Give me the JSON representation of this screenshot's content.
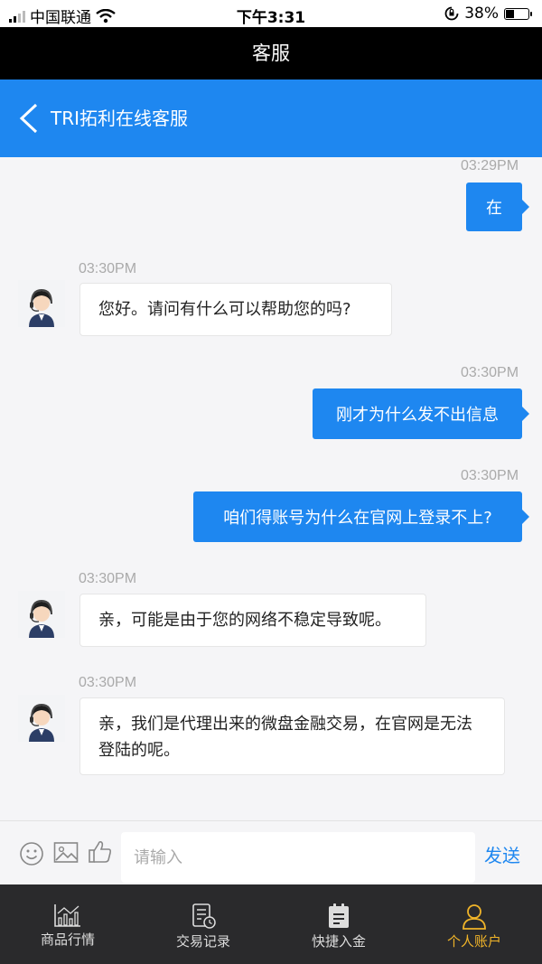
{
  "status_bar": {
    "carrier": "中国联通",
    "time": "下午3:31",
    "battery": "38%",
    "battery_level": 0.38
  },
  "title_bar": {
    "title": "客服"
  },
  "chat_header": {
    "title": "TRI拓利在线客服"
  },
  "messages": [
    {
      "side": "out",
      "time": "03:29PM",
      "text": "在"
    },
    {
      "side": "in",
      "time": "03:30PM",
      "text": "您好。请问有什么可以帮助您的吗?"
    },
    {
      "side": "out",
      "time": "03:30PM",
      "text": "刚才为什么发不出信息"
    },
    {
      "side": "out",
      "time": "03:30PM",
      "text": "咱们得账号为什么在官网上登录不上?"
    },
    {
      "side": "in",
      "time": "03:30PM",
      "text": "亲，可能是由于您的网络不稳定导致呢。"
    },
    {
      "side": "in",
      "time": "03:30PM",
      "text": "亲，我们是代理出来的微盘金融交易，在官网是无法登陆的呢。"
    }
  ],
  "input_bar": {
    "placeholder": "请输入",
    "send_label": "发送"
  },
  "tabs": [
    {
      "label": "商品行情",
      "icon": "chart-icon"
    },
    {
      "label": "交易记录",
      "icon": "record-icon"
    },
    {
      "label": "快捷入金",
      "icon": "deposit-icon"
    },
    {
      "label": "个人账户",
      "icon": "user-icon",
      "active": true
    }
  ],
  "colors": {
    "accent": "#1e87f0",
    "tab_active": "#f0b429",
    "tab_bar_bg": "#2a2a2c"
  }
}
